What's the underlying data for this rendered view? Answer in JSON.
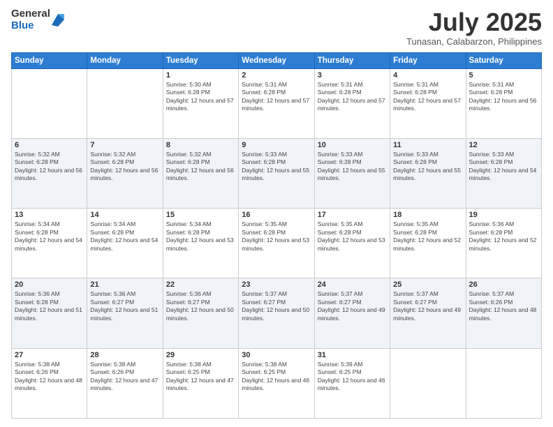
{
  "logo": {
    "general": "General",
    "blue": "Blue"
  },
  "header": {
    "month": "July 2025",
    "location": "Tunasan, Calabarzon, Philippines"
  },
  "weekdays": [
    "Sunday",
    "Monday",
    "Tuesday",
    "Wednesday",
    "Thursday",
    "Friday",
    "Saturday"
  ],
  "weeks": [
    [
      {
        "day": "",
        "sunrise": "",
        "sunset": "",
        "daylight": ""
      },
      {
        "day": "",
        "sunrise": "",
        "sunset": "",
        "daylight": ""
      },
      {
        "day": "1",
        "sunrise": "Sunrise: 5:30 AM",
        "sunset": "Sunset: 6:28 PM",
        "daylight": "Daylight: 12 hours and 57 minutes."
      },
      {
        "day": "2",
        "sunrise": "Sunrise: 5:31 AM",
        "sunset": "Sunset: 6:28 PM",
        "daylight": "Daylight: 12 hours and 57 minutes."
      },
      {
        "day": "3",
        "sunrise": "Sunrise: 5:31 AM",
        "sunset": "Sunset: 6:28 PM",
        "daylight": "Daylight: 12 hours and 57 minutes."
      },
      {
        "day": "4",
        "sunrise": "Sunrise: 5:31 AM",
        "sunset": "Sunset: 6:28 PM",
        "daylight": "Daylight: 12 hours and 57 minutes."
      },
      {
        "day": "5",
        "sunrise": "Sunrise: 5:31 AM",
        "sunset": "Sunset: 6:28 PM",
        "daylight": "Daylight: 12 hours and 56 minutes."
      }
    ],
    [
      {
        "day": "6",
        "sunrise": "Sunrise: 5:32 AM",
        "sunset": "Sunset: 6:28 PM",
        "daylight": "Daylight: 12 hours and 56 minutes."
      },
      {
        "day": "7",
        "sunrise": "Sunrise: 5:32 AM",
        "sunset": "Sunset: 6:28 PM",
        "daylight": "Daylight: 12 hours and 56 minutes."
      },
      {
        "day": "8",
        "sunrise": "Sunrise: 5:32 AM",
        "sunset": "Sunset: 6:28 PM",
        "daylight": "Daylight: 12 hours and 56 minutes."
      },
      {
        "day": "9",
        "sunrise": "Sunrise: 5:33 AM",
        "sunset": "Sunset: 6:28 PM",
        "daylight": "Daylight: 12 hours and 55 minutes."
      },
      {
        "day": "10",
        "sunrise": "Sunrise: 5:33 AM",
        "sunset": "Sunset: 6:28 PM",
        "daylight": "Daylight: 12 hours and 55 minutes."
      },
      {
        "day": "11",
        "sunrise": "Sunrise: 5:33 AM",
        "sunset": "Sunset: 6:28 PM",
        "daylight": "Daylight: 12 hours and 55 minutes."
      },
      {
        "day": "12",
        "sunrise": "Sunrise: 5:33 AM",
        "sunset": "Sunset: 6:28 PM",
        "daylight": "Daylight: 12 hours and 54 minutes."
      }
    ],
    [
      {
        "day": "13",
        "sunrise": "Sunrise: 5:34 AM",
        "sunset": "Sunset: 6:28 PM",
        "daylight": "Daylight: 12 hours and 54 minutes."
      },
      {
        "day": "14",
        "sunrise": "Sunrise: 5:34 AM",
        "sunset": "Sunset: 6:28 PM",
        "daylight": "Daylight: 12 hours and 54 minutes."
      },
      {
        "day": "15",
        "sunrise": "Sunrise: 5:34 AM",
        "sunset": "Sunset: 6:28 PM",
        "daylight": "Daylight: 12 hours and 53 minutes."
      },
      {
        "day": "16",
        "sunrise": "Sunrise: 5:35 AM",
        "sunset": "Sunset: 6:28 PM",
        "daylight": "Daylight: 12 hours and 53 minutes."
      },
      {
        "day": "17",
        "sunrise": "Sunrise: 5:35 AM",
        "sunset": "Sunset: 6:28 PM",
        "daylight": "Daylight: 12 hours and 53 minutes."
      },
      {
        "day": "18",
        "sunrise": "Sunrise: 5:35 AM",
        "sunset": "Sunset: 6:28 PM",
        "daylight": "Daylight: 12 hours and 52 minutes."
      },
      {
        "day": "19",
        "sunrise": "Sunrise: 5:36 AM",
        "sunset": "Sunset: 6:28 PM",
        "daylight": "Daylight: 12 hours and 52 minutes."
      }
    ],
    [
      {
        "day": "20",
        "sunrise": "Sunrise: 5:36 AM",
        "sunset": "Sunset: 6:28 PM",
        "daylight": "Daylight: 12 hours and 51 minutes."
      },
      {
        "day": "21",
        "sunrise": "Sunrise: 5:36 AM",
        "sunset": "Sunset: 6:27 PM",
        "daylight": "Daylight: 12 hours and 51 minutes."
      },
      {
        "day": "22",
        "sunrise": "Sunrise: 5:36 AM",
        "sunset": "Sunset: 6:27 PM",
        "daylight": "Daylight: 12 hours and 50 minutes."
      },
      {
        "day": "23",
        "sunrise": "Sunrise: 5:37 AM",
        "sunset": "Sunset: 6:27 PM",
        "daylight": "Daylight: 12 hours and 50 minutes."
      },
      {
        "day": "24",
        "sunrise": "Sunrise: 5:37 AM",
        "sunset": "Sunset: 6:27 PM",
        "daylight": "Daylight: 12 hours and 49 minutes."
      },
      {
        "day": "25",
        "sunrise": "Sunrise: 5:37 AM",
        "sunset": "Sunset: 6:27 PM",
        "daylight": "Daylight: 12 hours and 49 minutes."
      },
      {
        "day": "26",
        "sunrise": "Sunrise: 5:37 AM",
        "sunset": "Sunset: 6:26 PM",
        "daylight": "Daylight: 12 hours and 48 minutes."
      }
    ],
    [
      {
        "day": "27",
        "sunrise": "Sunrise: 5:38 AM",
        "sunset": "Sunset: 6:26 PM",
        "daylight": "Daylight: 12 hours and 48 minutes."
      },
      {
        "day": "28",
        "sunrise": "Sunrise: 5:38 AM",
        "sunset": "Sunset: 6:26 PM",
        "daylight": "Daylight: 12 hours and 47 minutes."
      },
      {
        "day": "29",
        "sunrise": "Sunrise: 5:38 AM",
        "sunset": "Sunset: 6:25 PM",
        "daylight": "Daylight: 12 hours and 47 minutes."
      },
      {
        "day": "30",
        "sunrise": "Sunrise: 5:38 AM",
        "sunset": "Sunset: 6:25 PM",
        "daylight": "Daylight: 12 hours and 46 minutes."
      },
      {
        "day": "31",
        "sunrise": "Sunrise: 5:39 AM",
        "sunset": "Sunset: 6:25 PM",
        "daylight": "Daylight: 12 hours and 46 minutes."
      },
      {
        "day": "",
        "sunrise": "",
        "sunset": "",
        "daylight": ""
      },
      {
        "day": "",
        "sunrise": "",
        "sunset": "",
        "daylight": ""
      }
    ]
  ]
}
